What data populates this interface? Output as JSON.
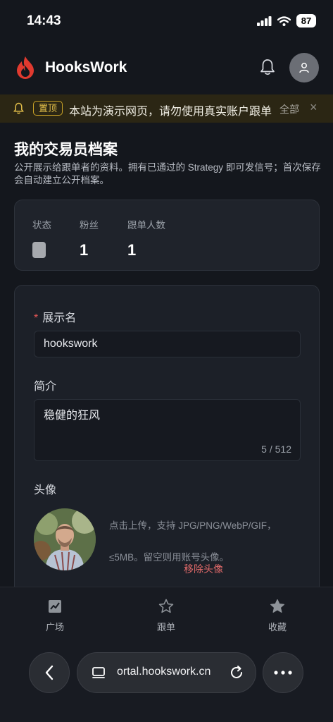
{
  "status_bar": {
    "time": "14:43",
    "battery": "87"
  },
  "header": {
    "brand": "HooksWork"
  },
  "notice": {
    "tag": "置顶",
    "text": "本站为演示网页，请勿使用真实账户跟单",
    "all_label": "全部",
    "close_glyph": "×"
  },
  "page": {
    "title": "我的交易员档案",
    "description": "公开展示给跟单者的资料。拥有已通过的 Strategy 即可发信号；首次保存会自动建立公开档案。"
  },
  "stats": {
    "status_label": "状态",
    "fans_label": "粉丝",
    "fans_value": "1",
    "followers_label": "跟单人数",
    "followers_value": "1"
  },
  "form": {
    "display_name_required": "*",
    "display_name_label": "展示名",
    "display_name_value": "hookswork",
    "bio_label": "简介",
    "bio_value": "稳健的狂风",
    "bio_counter": "5 / 512",
    "avatar_label": "头像",
    "upload_hint": "点击上传，支持 JPG/PNG/WebP/GIF，≤5MB。留空则用账号头像。",
    "remove_avatar": "移除头像"
  },
  "bottom_nav": {
    "items": [
      {
        "label": "广场",
        "icon": "trend-chart-icon"
      },
      {
        "label": "跟单",
        "icon": "star-outline-icon"
      },
      {
        "label": "收藏",
        "icon": "star-filled-icon"
      }
    ]
  },
  "browser": {
    "url": "ortal.hookswork.cn"
  },
  "colors": {
    "background": "#14171d",
    "card": "#1f232b",
    "brand_red": "#e03a2f",
    "notice_bg": "#2b2614",
    "notice_accent": "#e4c04a",
    "danger": "#e06a6a"
  }
}
